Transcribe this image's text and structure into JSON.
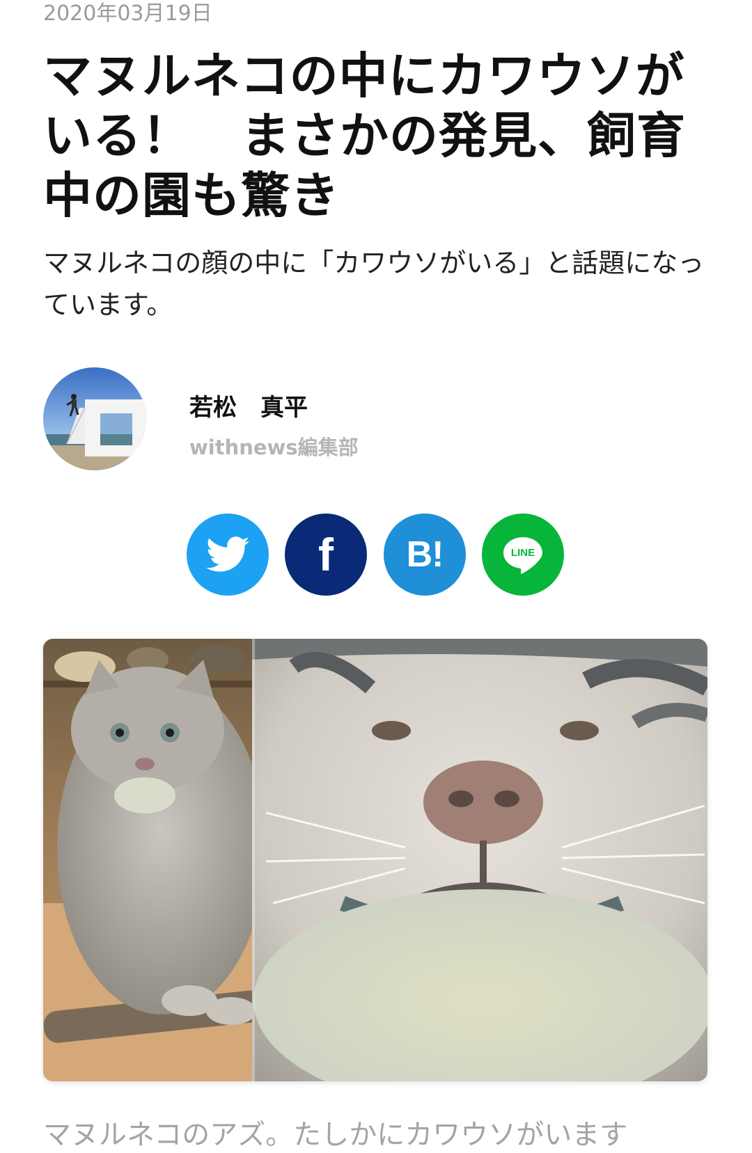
{
  "article": {
    "date": "2020年03月19日",
    "title": "マヌルネコの中にカワウソがいる！　まさかの発見、飼育中の園も驚き",
    "lead": "マヌルネコの顔の中に「カワウソがいる」と話題になっています。"
  },
  "author": {
    "name": "若松　真平",
    "department": "withnews編集部"
  },
  "share": {
    "twitter_icon": "twitter-bird-icon",
    "facebook_label": "f",
    "hatena_label": "B!",
    "line_label": "LINE",
    "colors": {
      "twitter": "#1da1f2",
      "facebook": "#0a2a78",
      "hatena": "#1f8fd8",
      "line": "#07b53b"
    }
  },
  "photo": {
    "caption": "マヌルネコのアズ。たしかにカワウソがいます"
  }
}
